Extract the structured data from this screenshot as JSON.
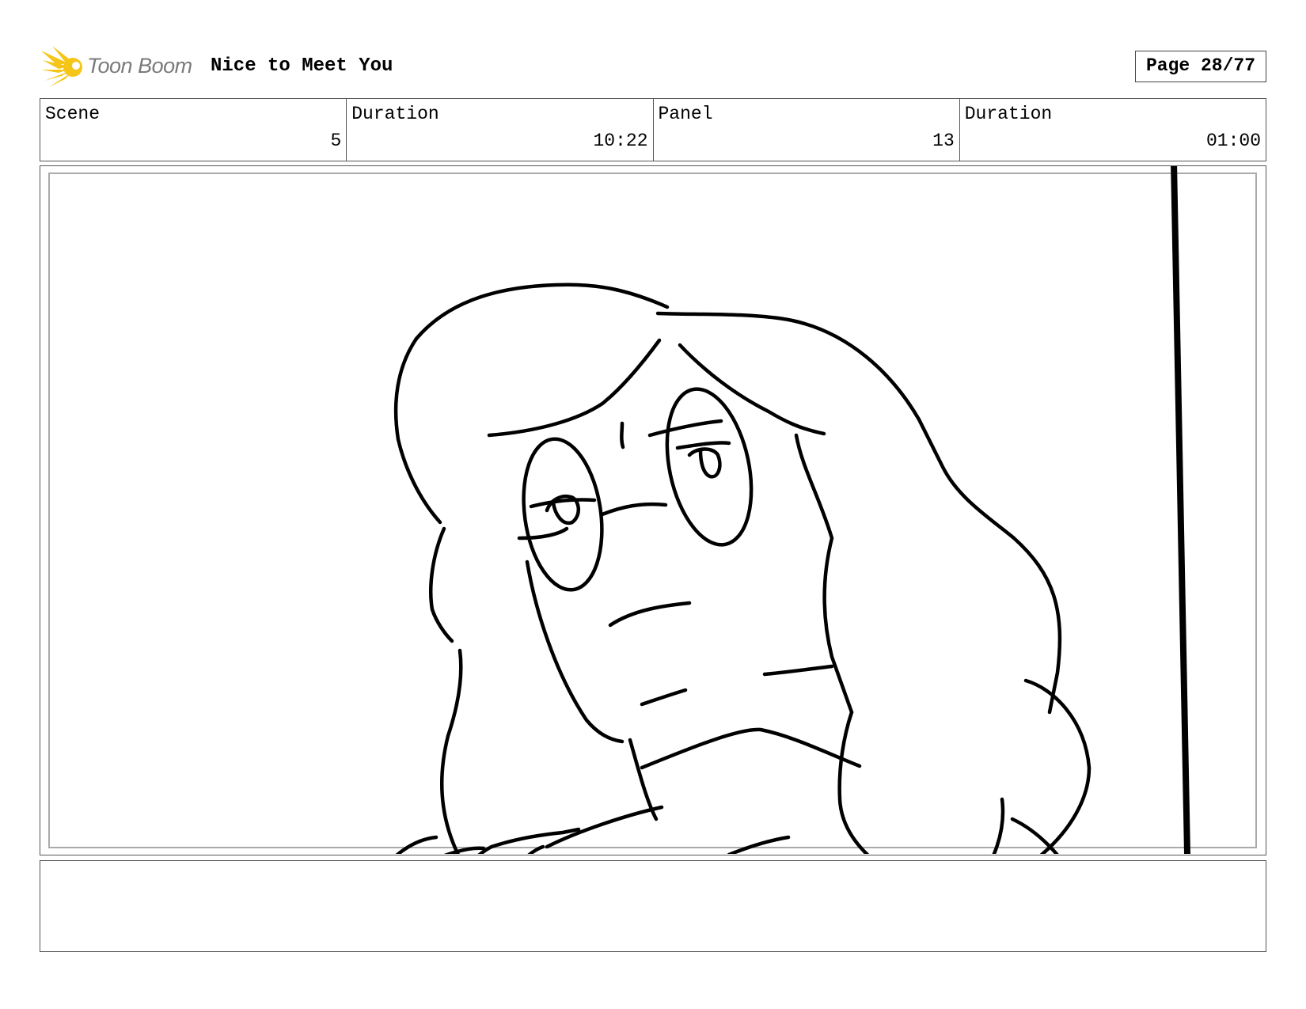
{
  "header": {
    "logo_text": "Toon Boom",
    "title": "Nice to Meet You",
    "page": "Page 28/77"
  },
  "info": {
    "scene_label": "Scene",
    "scene_value": "5",
    "scene_duration_label": "Duration",
    "scene_duration_value": "10:22",
    "panel_label": "Panel",
    "panel_value": "13",
    "panel_duration_label": "Duration",
    "panel_duration_value": "01:00"
  },
  "colors": {
    "logo_accent": "#f5c518",
    "logo_text": "#7a7a7a"
  },
  "notes": {
    "text": ""
  }
}
